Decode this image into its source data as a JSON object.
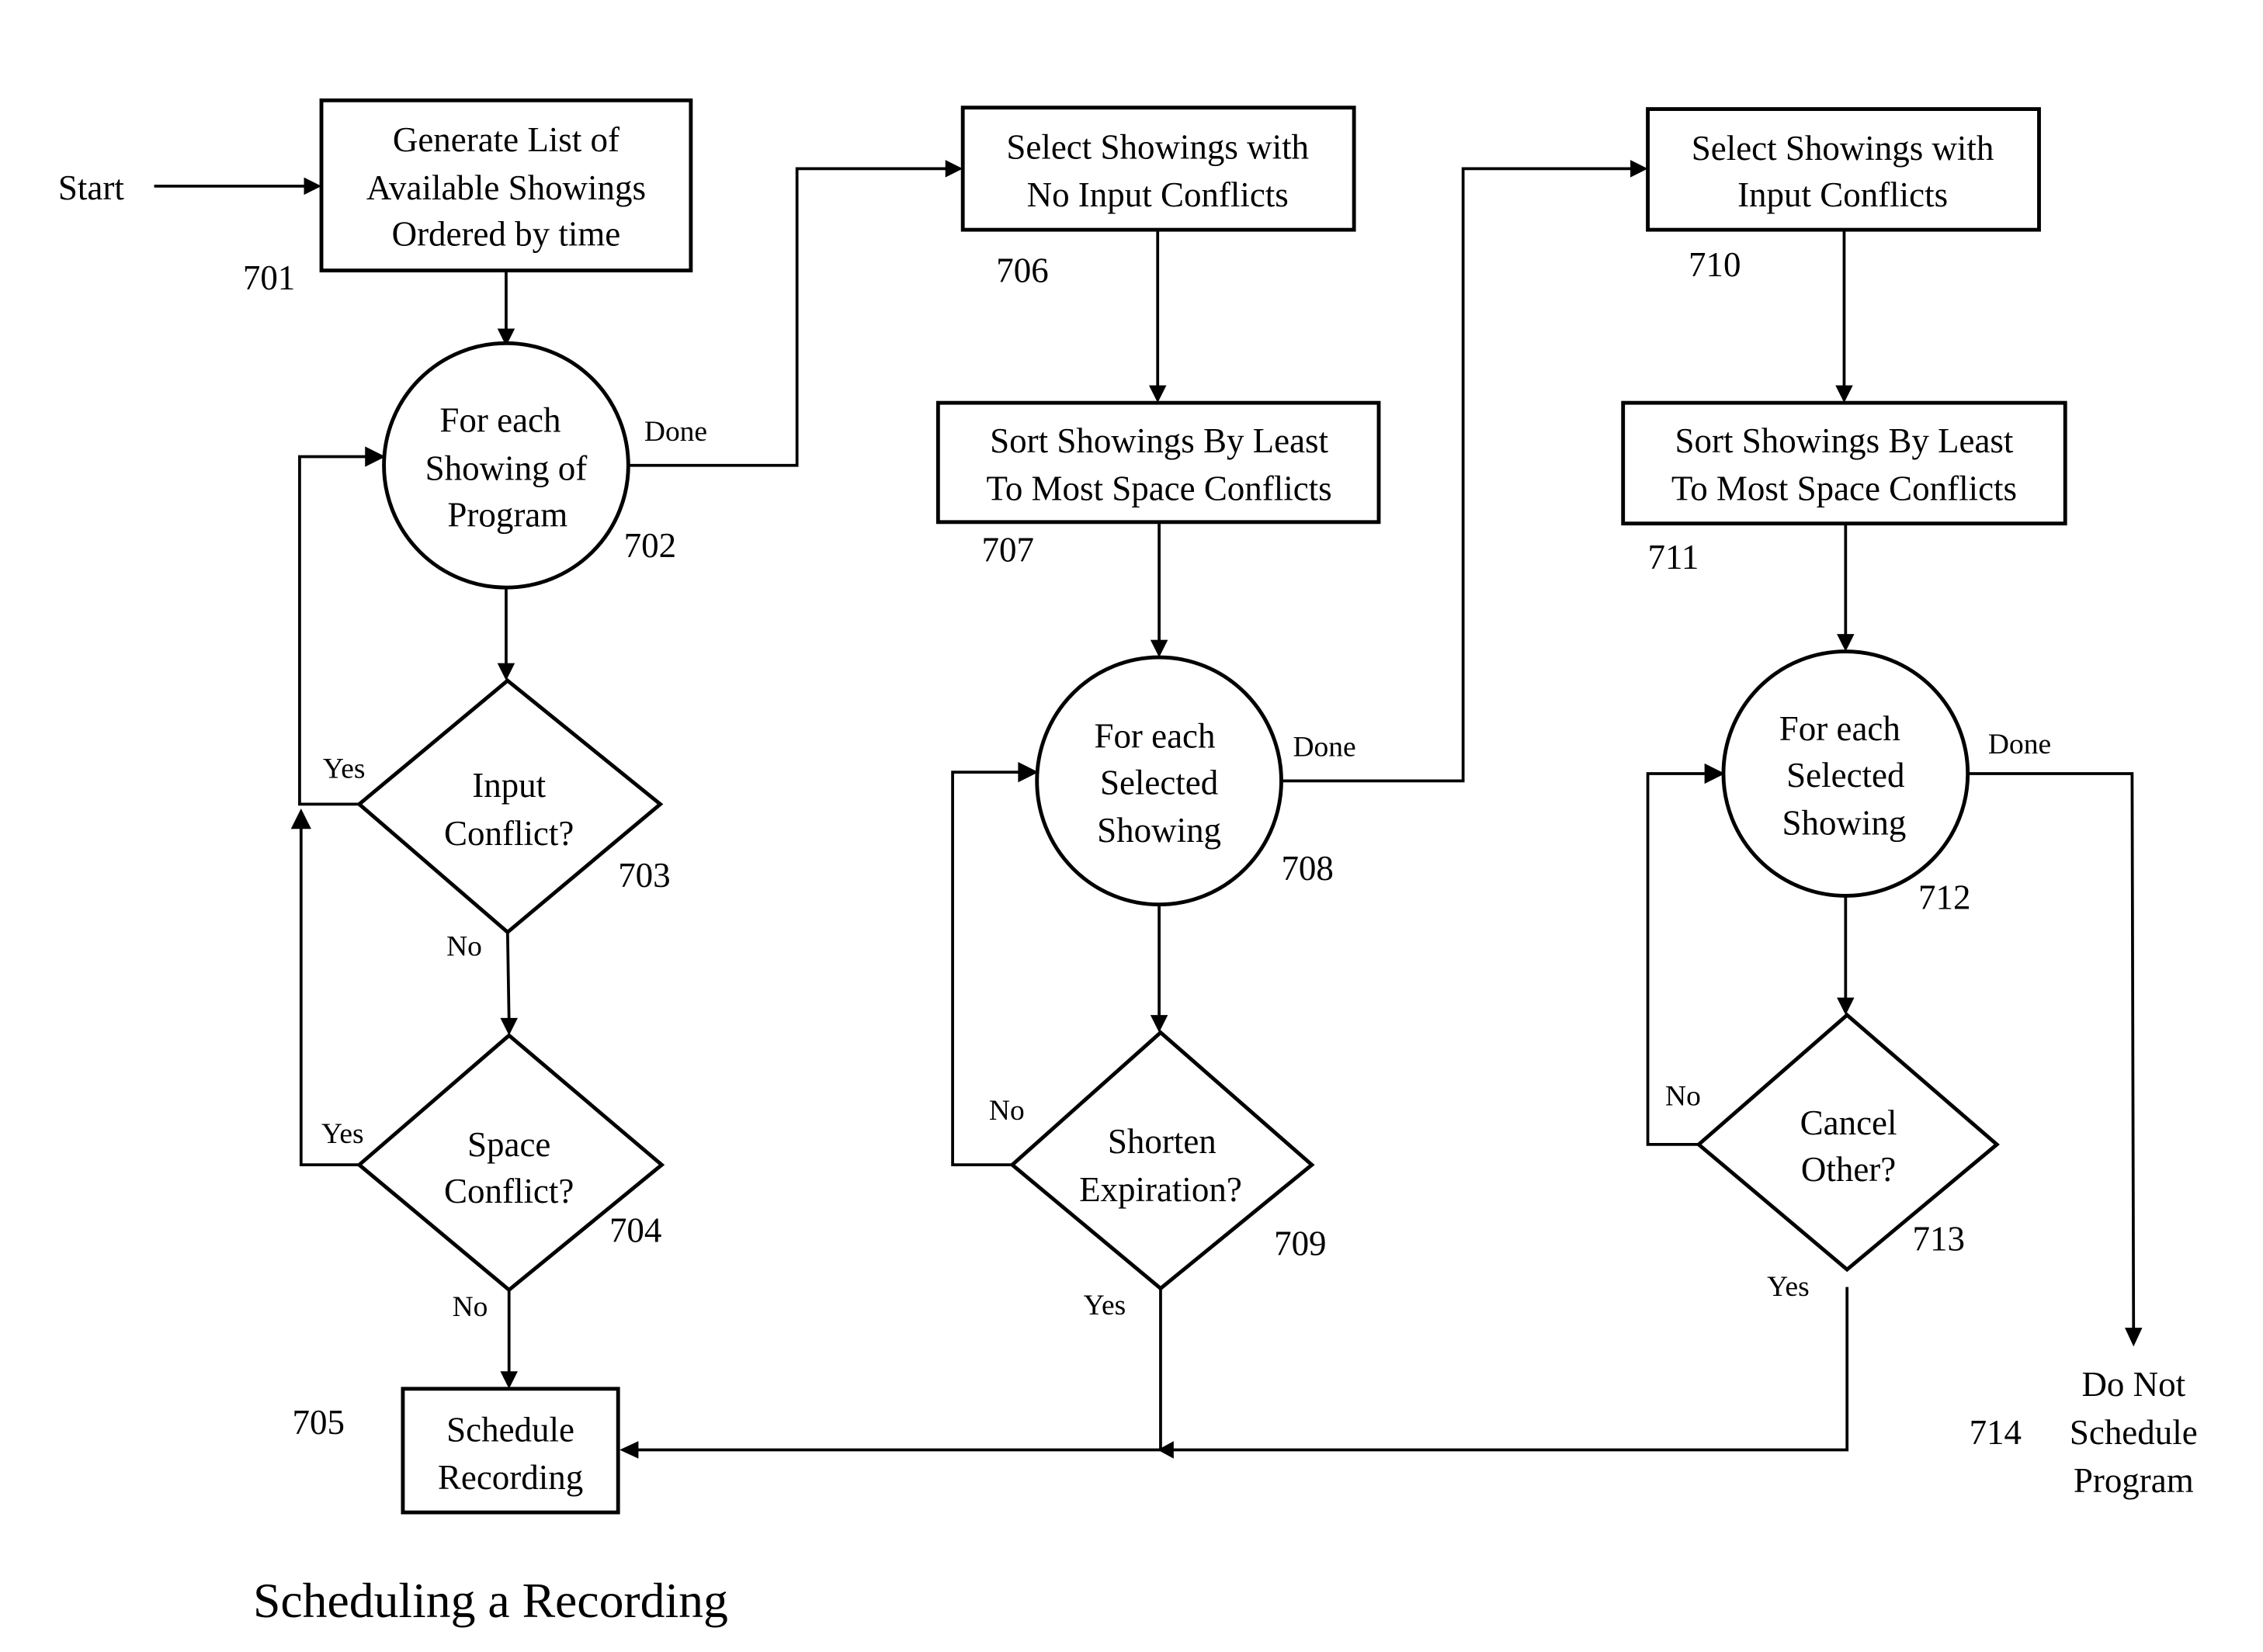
{
  "diagram": {
    "title": "Scheduling a Recording",
    "start_label": "Start",
    "nodes": {
      "n701": {
        "id": "701",
        "shape": "box",
        "lines": [
          "Generate List of",
          "Available Showings",
          "Ordered by time"
        ]
      },
      "n702": {
        "id": "702",
        "shape": "circle",
        "lines": [
          "For each",
          "Showing of",
          "Program"
        ]
      },
      "n703": {
        "id": "703",
        "shape": "diamond",
        "lines": [
          "Input",
          "Conflict?"
        ]
      },
      "n704": {
        "id": "704",
        "shape": "diamond",
        "lines": [
          "Space",
          "Conflict?"
        ]
      },
      "n705": {
        "id": "705",
        "shape": "box",
        "lines": [
          "Schedule",
          "Recording"
        ]
      },
      "n706": {
        "id": "706",
        "shape": "box",
        "lines": [
          "Select Showings with",
          "No Input Conflicts"
        ]
      },
      "n707": {
        "id": "707",
        "shape": "box",
        "lines": [
          "Sort Showings By Least",
          "To Most Space Conflicts"
        ]
      },
      "n708": {
        "id": "708",
        "shape": "circle",
        "lines": [
          "For each",
          "Selected",
          "Showing"
        ]
      },
      "n709": {
        "id": "709",
        "shape": "diamond",
        "lines": [
          "Shorten",
          "Expiration?"
        ]
      },
      "n710": {
        "id": "710",
        "shape": "box",
        "lines": [
          "Select Showings with",
          "Input Conflicts"
        ]
      },
      "n711": {
        "id": "711",
        "shape": "box",
        "lines": [
          "Sort Showings By Least",
          "To Most Space Conflicts"
        ]
      },
      "n712": {
        "id": "712",
        "shape": "circle",
        "lines": [
          "For each",
          "Selected",
          "Showing"
        ]
      },
      "n713": {
        "id": "713",
        "shape": "diamond",
        "lines": [
          "Cancel",
          "Other?"
        ]
      },
      "n714": {
        "id": "714",
        "shape": "text",
        "lines": [
          "Do Not",
          "Schedule",
          "Program"
        ]
      }
    },
    "edge_labels": {
      "done_702": "Done",
      "yes_703": "Yes",
      "no_703": "No",
      "yes_704": "Yes",
      "no_704": "No",
      "done_708": "Done",
      "no_709": "No",
      "yes_709": "Yes",
      "done_712": "Done",
      "no_713": "No",
      "yes_713": "Yes"
    },
    "edges": [
      {
        "from": "start",
        "to": "701"
      },
      {
        "from": "701",
        "to": "702"
      },
      {
        "from": "702",
        "to": "703"
      },
      {
        "from": "703",
        "to": "702",
        "label": "Yes"
      },
      {
        "from": "703",
        "to": "704",
        "label": "No"
      },
      {
        "from": "704",
        "to": "702",
        "label": "Yes"
      },
      {
        "from": "704",
        "to": "705",
        "label": "No"
      },
      {
        "from": "702",
        "to": "706",
        "label": "Done"
      },
      {
        "from": "706",
        "to": "707"
      },
      {
        "from": "707",
        "to": "708"
      },
      {
        "from": "708",
        "to": "709"
      },
      {
        "from": "709",
        "to": "708",
        "label": "No"
      },
      {
        "from": "709",
        "to": "705",
        "label": "Yes"
      },
      {
        "from": "708",
        "to": "710",
        "label": "Done"
      },
      {
        "from": "710",
        "to": "711"
      },
      {
        "from": "711",
        "to": "712"
      },
      {
        "from": "712",
        "to": "713"
      },
      {
        "from": "713",
        "to": "712",
        "label": "No"
      },
      {
        "from": "713",
        "to": "705",
        "label": "Yes"
      },
      {
        "from": "712",
        "to": "714",
        "label": "Done"
      }
    ]
  }
}
